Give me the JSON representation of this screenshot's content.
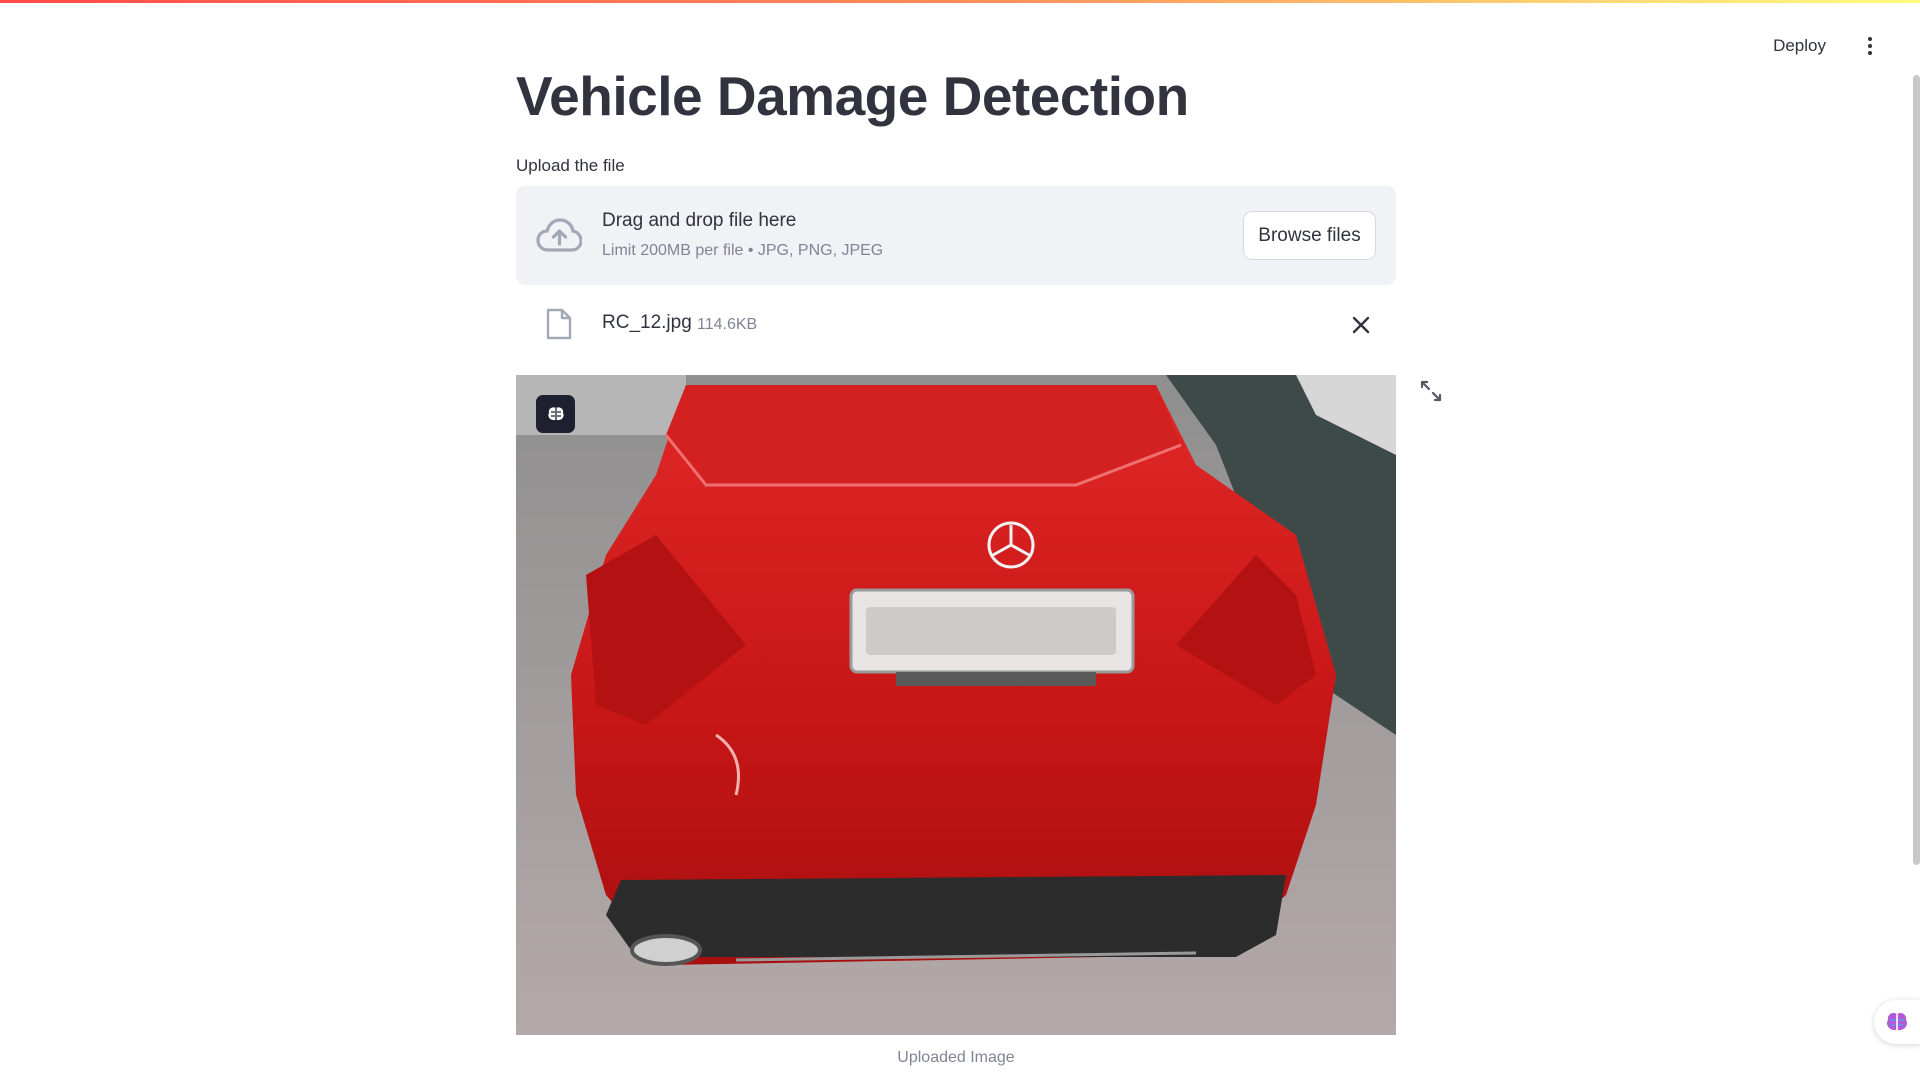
{
  "header": {
    "deploy_label": "Deploy",
    "menu_icon": "kebab-menu-icon"
  },
  "main": {
    "title": "Vehicle Damage Detection",
    "upload_label": "Upload the file"
  },
  "dropzone": {
    "icon": "cloud-upload-icon",
    "title": "Drag and drop file here",
    "subtitle": "Limit 200MB per file • JPG, PNG, JPEG",
    "browse_label": "Browse files"
  },
  "uploaded_file": {
    "icon": "file-icon",
    "name": "RC_12.jpg",
    "size": "114.6KB",
    "remove_icon": "close-icon"
  },
  "image": {
    "caption": "Uploaded Image",
    "expand_icon": "fullscreen-icon",
    "badge_icon": "brain-icon"
  },
  "colors": {
    "accent": "#ff4b4b",
    "text": "#31333f",
    "muted": "#808495",
    "dropzone_bg": "#f0f2f6",
    "car_red": "#d01818"
  }
}
